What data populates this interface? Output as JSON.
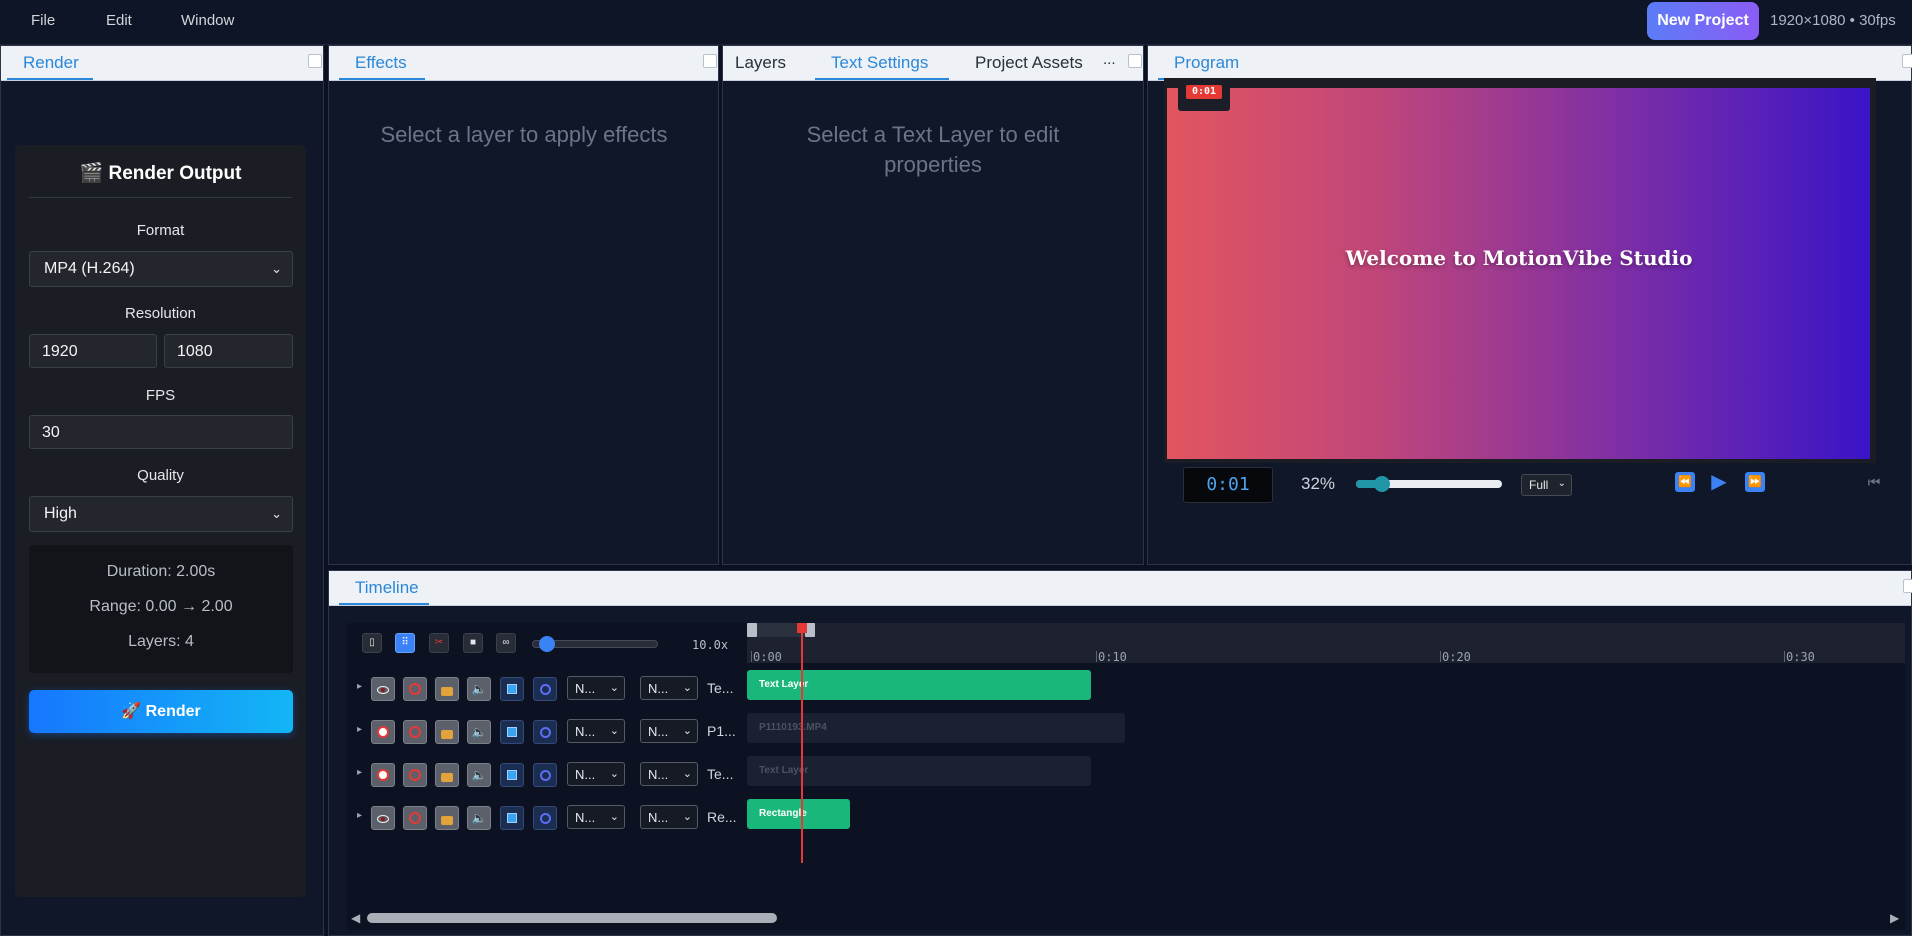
{
  "menubar": {
    "items": [
      "File",
      "Edit",
      "Window"
    ],
    "new_project_label": "New Project",
    "project_info": "1920×1080 • 30fps"
  },
  "render_panel": {
    "tab": "Render",
    "title": "🎬 Render Output",
    "format_label": "Format",
    "format_value": "MP4 (H.264)",
    "resolution_label": "Resolution",
    "width": "1920",
    "height": "1080",
    "fps_label": "FPS",
    "fps_value": "30",
    "quality_label": "Quality",
    "quality_value": "High",
    "duration": "Duration: 2.00s",
    "range": "Range: 0.00 → 2.00",
    "layers": "Layers: 4",
    "render_button": "🚀 Render"
  },
  "effects_panel": {
    "tab": "Effects",
    "placeholder": "Select a layer to apply effects"
  },
  "settings_panel": {
    "tabs": [
      "Layers",
      "Text Settings",
      "Project Assets"
    ],
    "active_tab": "Text Settings",
    "overflow": "...",
    "placeholder": "Select a Text Layer to edit properties"
  },
  "program_panel": {
    "tab": "Program",
    "canvas_text": "Welcome to MotionVibe Studio",
    "time_badge": "0:01",
    "time_display": "0:01",
    "zoom_percent": "32%",
    "zoom_fraction": 0.18,
    "quality_select": "Full",
    "gradient_colors": [
      "#e2555f",
      "#3a14c7"
    ]
  },
  "timeline": {
    "tab": "Timeline",
    "zoom_value": "10.0x",
    "zoom_fraction": 0.05,
    "ruler_ticks": [
      "0:00",
      "0:10",
      "0:20",
      "0:30"
    ],
    "playhead_time": "0:01",
    "tracks": [
      {
        "visible": true,
        "blend": "N...",
        "mode": "N...",
        "name": "Te...",
        "clip_label": "Text Layer",
        "clip_start": 0,
        "clip_end": 10,
        "active": true
      },
      {
        "visible": false,
        "blend": "N...",
        "mode": "N...",
        "name": "P1...",
        "clip_label": "P1110193.MP4",
        "clip_start": 0,
        "clip_end": 11,
        "active": false
      },
      {
        "visible": false,
        "blend": "N...",
        "mode": "N...",
        "name": "Te...",
        "clip_label": "Text Layer",
        "clip_start": 0,
        "clip_end": 10,
        "active": false
      },
      {
        "visible": true,
        "blend": "N...",
        "mode": "N...",
        "name": "Re...",
        "clip_label": "Rectangle",
        "clip_start": 0,
        "clip_end": 3,
        "active": true
      }
    ]
  },
  "colors": {
    "accent": "#2b88d8",
    "clip_active": "#19b87a",
    "playhead": "#e53935",
    "render_button": "#1677ff"
  }
}
